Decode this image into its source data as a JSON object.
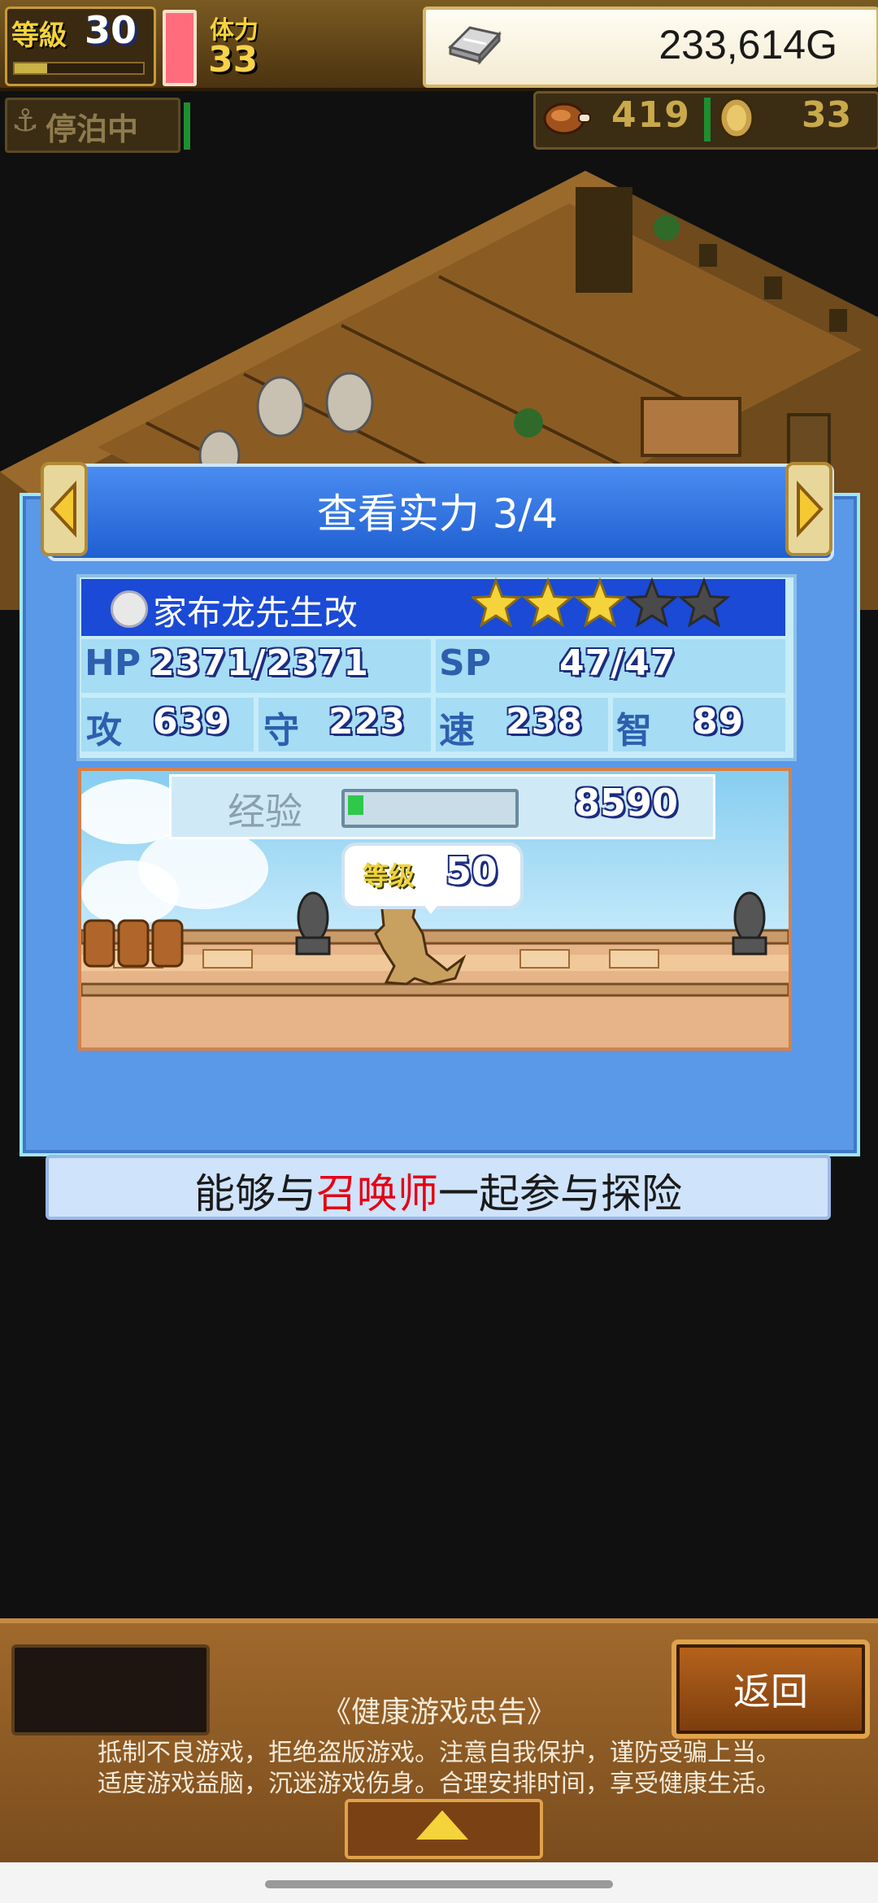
{
  "hud": {
    "level_label": "等級",
    "level": "30",
    "stamina_label": "体力",
    "stamina": "33",
    "gold": "233,614G",
    "status_icon": "anchor-icon",
    "status": "停泊中",
    "food": "419",
    "coins": "33"
  },
  "panel": {
    "title": "查看实力 3/4",
    "monster_name": "家布龙先生改",
    "stars_filled": 3,
    "stars_total": 5,
    "stats": {
      "hp_label": "HP",
      "hp": "2371/2371",
      "sp_label": "SP",
      "sp": "47/47",
      "atk_label": "攻",
      "atk": "639",
      "def_label": "守",
      "def": "223",
      "spd_label": "速",
      "spd": "238",
      "int_label": "智",
      "int": "89"
    },
    "exp_label": "经验",
    "exp": "8590",
    "exp_fill_fraction": 0.1,
    "level_label": "等级",
    "level": "50",
    "desc_before": "能够与",
    "desc_highlight": "召唤师",
    "desc_after": "一起参与探险"
  },
  "bottom": {
    "back_label": "返回",
    "notice_title": "《健康游戏忠告》",
    "notice_line1": "抵制不良游戏，拒绝盗版游戏。注意自我保护，谨防受骗上当。",
    "notice_line2": "适度游戏益脑，沉迷游戏伤身。合理安排时间，享受健康生活。"
  },
  "colors": {
    "accent_blue": "#1f5fd1",
    "highlight_red": "#e60012",
    "exp_green": "#2ec84a",
    "star_gold": "#f5d33a"
  }
}
